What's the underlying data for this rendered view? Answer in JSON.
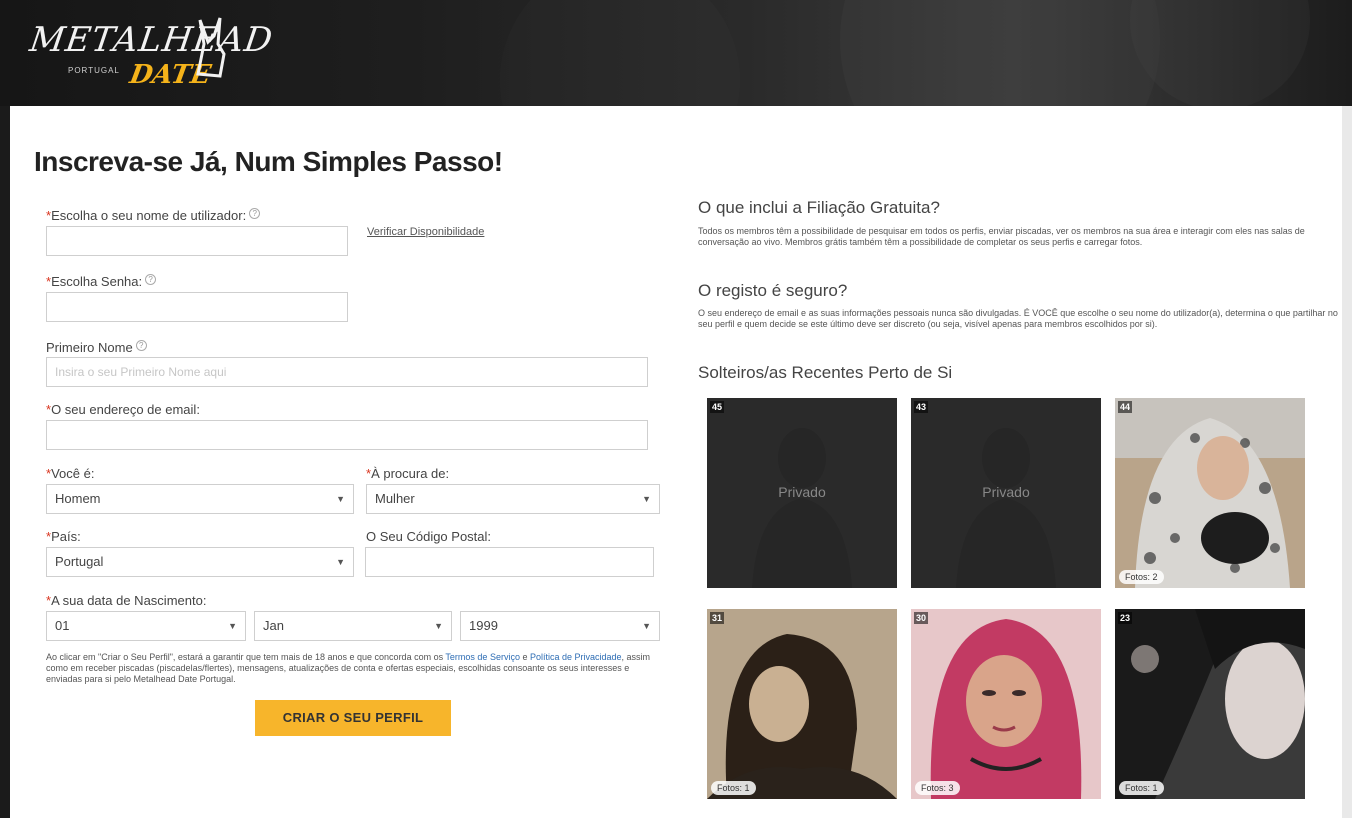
{
  "header": {
    "logo_main": "METALHEAD",
    "logo_country": "PORTUGAL",
    "logo_sub": "DATE"
  },
  "page_title": "Inscreva-se Já, Num Simples Passo!",
  "form": {
    "username_label": "Escolha o seu nome de utilizador:",
    "username_value": "",
    "verify_link": "Verificar Disponibilidade",
    "password_label": "Escolha Senha:",
    "password_value": "",
    "first_name_label": "Primeiro Nome",
    "first_name_placeholder": "Insira o seu Primeiro Nome aqui",
    "email_label": "O seu endereço de email:",
    "email_value": "",
    "you_are_label": "Você é:",
    "you_are_value": "Homem",
    "looking_for_label": "À procura de:",
    "looking_for_value": "Mulher",
    "country_label": "País:",
    "country_value": "Portugal",
    "postal_label": "O Seu Código Postal:",
    "postal_value": "",
    "dob_label": "A sua data de Nascimento:",
    "dob_day": "01",
    "dob_month": "Jan",
    "dob_year": "1999",
    "terms_before": "Ao clicar em \"Criar o Seu Perfil\", estará a garantir que tem mais de 18 anos e que concorda com os ",
    "terms_link": "Termos de Serviço",
    "terms_middle": " e ",
    "privacy_link": "Política de Privacidade",
    "terms_after": ", assim como em receber piscadas (piscadelas/flertes), mensagens, atualizações de conta e ofertas especiais, escolhidas consoante os seus interesses e enviadas para si pelo Metalhead Date Portugal.",
    "create_button": "CRIAR O SEU PERFIL"
  },
  "info": {
    "membership_title": "O que inclui a Filiação Gratuita?",
    "membership_text": "Todos os membros têm a possibilidade de pesquisar em todos os perfis, enviar piscadas, ver os membros na sua área e interagir com eles nas salas de conversação ao vivo. Membros grátis também têm a possibilidade de completar os seus perfis e carregar fotos.",
    "secure_title": "O registo é seguro?",
    "secure_text": "O seu endereço de email e as suas informações pessoais nunca são divulgadas. É VOCÊ que escolhe o seu nome do utilizador(a), determina o que partilhar no seu perfil e quem decide se este último deve ser discreto (ou seja, visível apenas para membros escolhidos por si).",
    "recent_title": "Solteiros/as Recentes Perto de Si"
  },
  "profiles": [
    {
      "age": "45",
      "private_label": "Privado",
      "photos": ""
    },
    {
      "age": "43",
      "private_label": "Privado",
      "photos": ""
    },
    {
      "age": "44",
      "private_label": "",
      "photos": "Fotos: 2"
    },
    {
      "age": "31",
      "private_label": "",
      "photos": "Fotos: 1"
    },
    {
      "age": "30",
      "private_label": "",
      "photos": "Fotos: 3"
    },
    {
      "age": "23",
      "private_label": "",
      "photos": "Fotos: 1"
    }
  ],
  "colors": {
    "accent": "#f7b52b",
    "required": "#d9341e",
    "link": "#2e6db4"
  }
}
